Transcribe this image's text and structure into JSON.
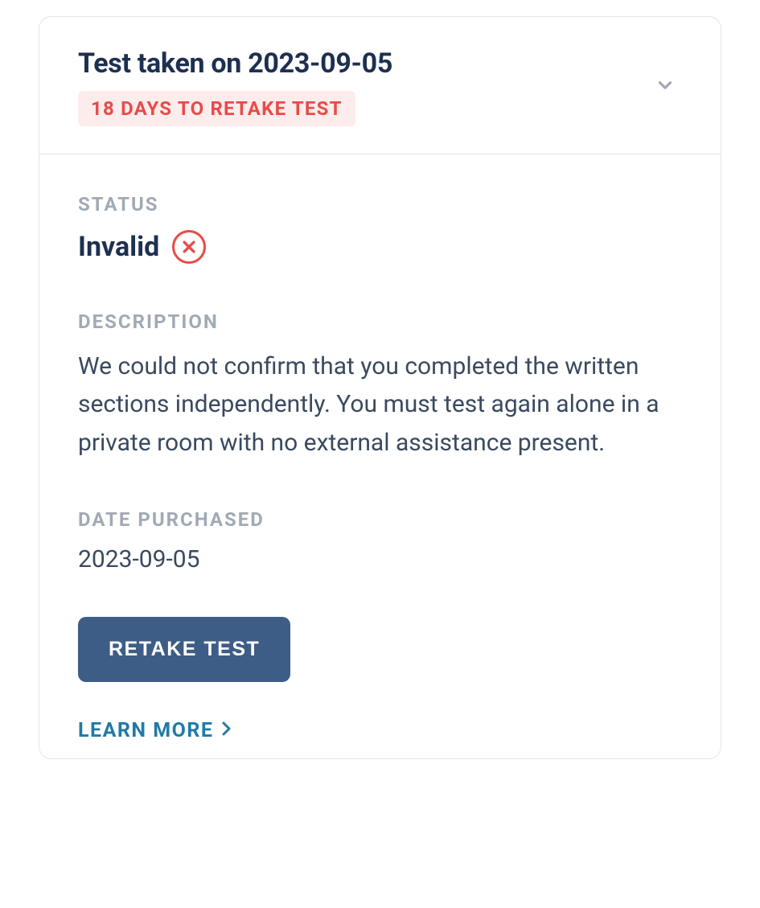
{
  "header": {
    "title": "Test taken on 2023-09-05",
    "retake_badge": "18 DAYS TO RETAKE TEST"
  },
  "status": {
    "label": "STATUS",
    "value": "Invalid"
  },
  "description": {
    "label": "DESCRIPTION",
    "text": "We could not confirm that you completed the written sections independently. You must test again alone in a private room with no external assistance present."
  },
  "date_purchased": {
    "label": "DATE PURCHASED",
    "value": "2023-09-05"
  },
  "actions": {
    "retake_button": "RETAKE TEST",
    "learn_more": "LEARN MORE"
  }
}
